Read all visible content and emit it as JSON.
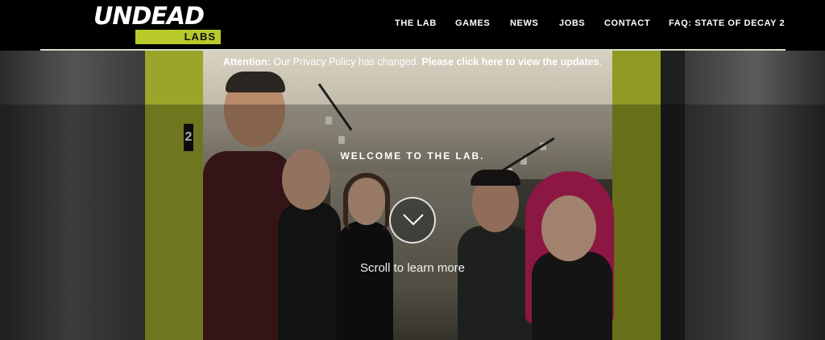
{
  "header": {
    "logo": {
      "top": "UNDEAD",
      "bottom": "LABS"
    },
    "nav": [
      {
        "label": "THE LAB"
      },
      {
        "label": "GAMES"
      },
      {
        "label": "NEWS"
      },
      {
        "label": "JOBS"
      },
      {
        "label": "CONTACT"
      },
      {
        "label": "FAQ: STATE OF DECAY 2"
      }
    ]
  },
  "notice": {
    "prefix": "Attention:",
    "message": " Our Privacy Policy has changed. ",
    "link": "Please click here to view the updates",
    "suffix": "."
  },
  "hero": {
    "welcome": "WELCOME TO THE LAB.",
    "door_number": "2",
    "scroll_text": "Scroll to learn more",
    "scroll_icon": "chevron-down-icon"
  },
  "colors": {
    "accent": "#b8c92a",
    "header_bg": "#000000",
    "text": "#ffffff"
  }
}
